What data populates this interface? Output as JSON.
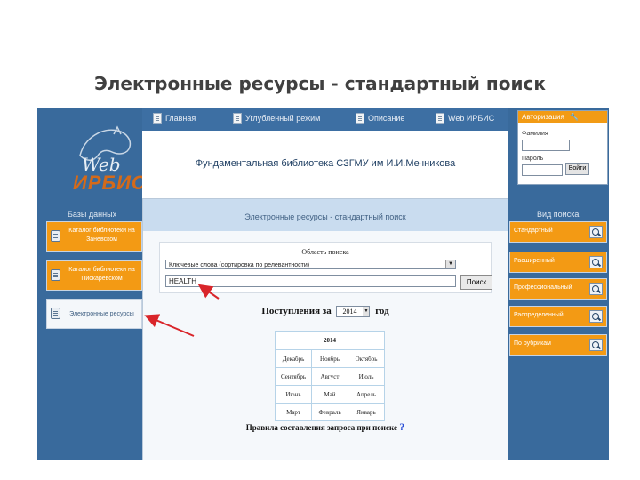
{
  "slide_title": "Электронные ресурсы - стандартный поиск",
  "nav": {
    "items": [
      {
        "label": "Главная"
      },
      {
        "label": "Углубленный режим"
      },
      {
        "label": "Описание"
      },
      {
        "label": "Web ИРБИС"
      }
    ]
  },
  "logo": {
    "web": "Web",
    "irbis": "ИРБИС"
  },
  "banner": {
    "title": "Фундаментальная библиотека СЗГМУ им И.И.Мечникова"
  },
  "auth": {
    "title": "Авторизация",
    "surname_label": "Фамилия",
    "password_label": "Пароль",
    "login_button": "Войти"
  },
  "left_sidebar": {
    "heading": "Базы данных",
    "items": [
      {
        "label": "Каталог библиотеки на Заневском"
      },
      {
        "label": "Каталог библиотеки на Пискаревском"
      },
      {
        "label": "Электронные ресурсы"
      }
    ]
  },
  "main": {
    "heading": "Электронные ресурсы - стандартный поиск",
    "search_area_label": "Область поиска",
    "search_area_value": "Ключевые слова (сортировка по релевантности)",
    "query_value": "HEALTH",
    "search_button": "Поиск",
    "arrivals_prefix": "Поступления за",
    "arrivals_year": "2014",
    "arrivals_suffix": "год",
    "calendar": {
      "year": "2014",
      "rows": [
        [
          "Декабрь",
          "Ноябрь",
          "Октябрь"
        ],
        [
          "Сентябрь",
          "Август",
          "Июль"
        ],
        [
          "Июнь",
          "Май",
          "Апрель"
        ],
        [
          "Март",
          "Февраль",
          "Январь"
        ]
      ]
    },
    "rules_text": "Правила составления запроса при поиске",
    "rules_icon": "?"
  },
  "right_sidebar": {
    "heading": "Вид поиска",
    "items": [
      {
        "label": "Стандартный"
      },
      {
        "label": "Расширенный"
      },
      {
        "label": "Профессиональный"
      },
      {
        "label": "Распределенный"
      },
      {
        "label": "По рубрикам"
      }
    ]
  },
  "colors": {
    "page_bg": "#396a9c",
    "accent_orange": "#f39a14",
    "arrow": "#d9252a"
  }
}
